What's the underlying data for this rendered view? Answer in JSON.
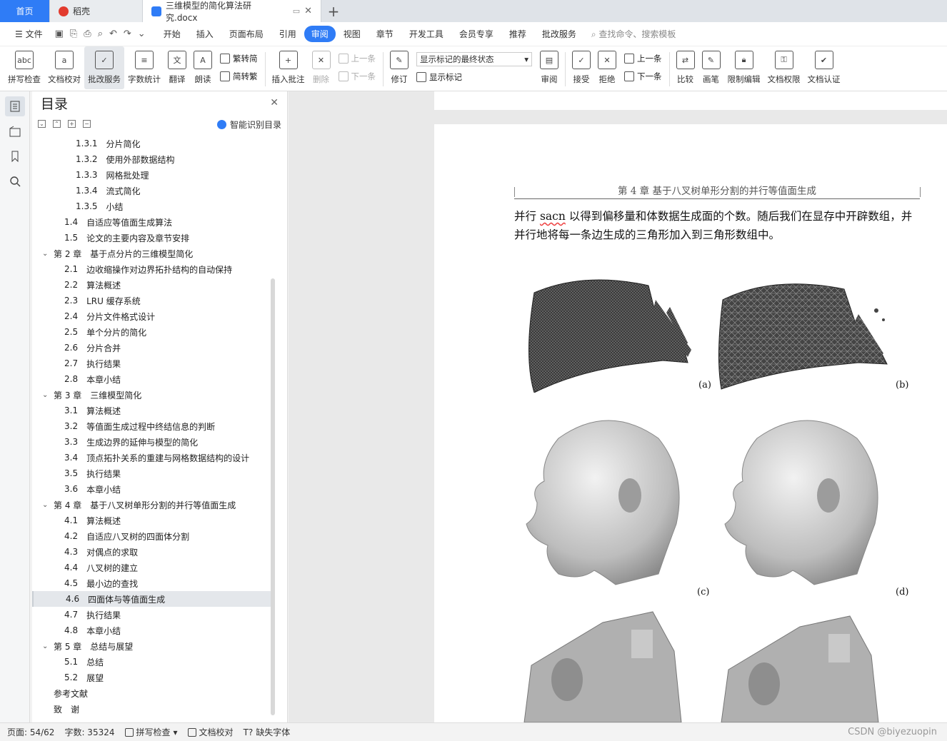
{
  "tabs": {
    "home": "首页",
    "daoke": "稻壳",
    "doc": "三维模型的简化算法研究.docx"
  },
  "menu": {
    "file": "文件",
    "items": [
      "开始",
      "插入",
      "页面布局",
      "引用",
      "审阅",
      "视图",
      "章节",
      "开发工具",
      "会员专享",
      "推荐",
      "批改服务"
    ],
    "active_index": 4,
    "search": "查找命令、搜索模板"
  },
  "ribbon": {
    "spellcheck": "拼写检查",
    "proofread": "文档校对",
    "correction": "批改服务",
    "wordcount": "字数统计",
    "translate": "翻译",
    "read": "朗读",
    "trad": "繁转简",
    "simp": "简转繁",
    "insert_comment": "插入批注",
    "delete": "删除",
    "prev": "上一条",
    "next": "下一条",
    "revise": "修订",
    "markup_state": "显示标记的最终状态",
    "show_markup": "显示标记",
    "review": "审阅",
    "accept": "接受",
    "reject": "拒绝",
    "prev2": "上一条",
    "next2": "下一条",
    "compare": "比较",
    "pen": "画笔",
    "restrict": "限制编辑",
    "permission": "文档权限",
    "certify": "文档认证"
  },
  "toc": {
    "title": "目录",
    "smart": "智能识别目录",
    "items": [
      {
        "level": 2,
        "num": "1.3.1",
        "text": "分片简化"
      },
      {
        "level": 2,
        "num": "1.3.2",
        "text": "使用外部数据结构"
      },
      {
        "level": 2,
        "num": "1.3.3",
        "text": "网格批处理"
      },
      {
        "level": 2,
        "num": "1.3.4",
        "text": "流式简化"
      },
      {
        "level": 2,
        "num": "1.3.5",
        "text": "小结"
      },
      {
        "level": 1,
        "num": "1.4",
        "text": "自适应等值面生成算法"
      },
      {
        "level": 1,
        "num": "1.5",
        "text": "论文的主要内容及章节安排"
      },
      {
        "level": 0,
        "num": "第 2 章",
        "text": "基于点分片的三维模型简化"
      },
      {
        "level": 1,
        "num": "2.1",
        "text": "边收缩操作对边界拓扑结构的自动保持"
      },
      {
        "level": 1,
        "num": "2.2",
        "text": "算法概述"
      },
      {
        "level": 1,
        "num": "2.3",
        "text": "LRU 缓存系统"
      },
      {
        "level": 1,
        "num": "2.4",
        "text": "分片文件格式设计"
      },
      {
        "level": 1,
        "num": "2.5",
        "text": "单个分片的简化"
      },
      {
        "level": 1,
        "num": "2.6",
        "text": "分片合并"
      },
      {
        "level": 1,
        "num": "2.7",
        "text": "执行结果"
      },
      {
        "level": 1,
        "num": "2.8",
        "text": "本章小结"
      },
      {
        "level": 0,
        "num": "第 3 章",
        "text": "三维模型简化"
      },
      {
        "level": 1,
        "num": "3.1",
        "text": "算法概述"
      },
      {
        "level": 1,
        "num": "3.2",
        "text": "等值面生成过程中终结信息的判断"
      },
      {
        "level": 1,
        "num": "3.3",
        "text": "生成边界的延伸与模型的简化"
      },
      {
        "level": 1,
        "num": "3.4",
        "text": "顶点拓扑关系的重建与网格数据结构的设计"
      },
      {
        "level": 1,
        "num": "3.5",
        "text": "执行结果"
      },
      {
        "level": 1,
        "num": "3.6",
        "text": "本章小结"
      },
      {
        "level": 0,
        "num": "第 4 章",
        "text": "基于八叉树单形分割的并行等值面生成"
      },
      {
        "level": 1,
        "num": "4.1",
        "text": "算法概述"
      },
      {
        "level": 1,
        "num": "4.2",
        "text": "自适应八叉树的四面体分割"
      },
      {
        "level": 1,
        "num": "4.3",
        "text": "对偶点的求取"
      },
      {
        "level": 1,
        "num": "4.4",
        "text": "八叉树的建立"
      },
      {
        "level": 1,
        "num": "4.5",
        "text": "最小边的查找"
      },
      {
        "level": 1,
        "num": "4.6",
        "text": "四面体与等值面生成",
        "selected": true
      },
      {
        "level": 1,
        "num": "4.7",
        "text": "执行结果"
      },
      {
        "level": 1,
        "num": "4.8",
        "text": "本章小结"
      },
      {
        "level": 0,
        "num": "第 5 章",
        "text": "总结与展望"
      },
      {
        "level": 1,
        "num": "5.1",
        "text": "总结"
      },
      {
        "level": 1,
        "num": "5.2",
        "text": "展望"
      },
      {
        "level": 3,
        "num": "",
        "text": "参考文献"
      },
      {
        "level": 3,
        "num": "",
        "text": "致　谢"
      }
    ]
  },
  "document": {
    "running_head": "第 4 章  基于八叉树单形分割的并行等值面生成",
    "para_pre": "并行 ",
    "para_sq": "sacn",
    "para_post": " 以得到偏移量和体数据生成面的个数。随后我们在显存中开辟数组，并并行地将每一条边生成的三角形加入到三角形数组中。",
    "labels": [
      "(a)",
      "(b)",
      "(c)",
      "(d)"
    ]
  },
  "status": {
    "page": "页面: 54/62",
    "words": "字数: 35324",
    "spell": "拼写检查",
    "proof": "文档校对",
    "font": "缺失字体",
    "watermark": "CSDN @biyezuopin"
  },
  "colors": {
    "accent": "#2f7cf6",
    "tabbar": "#dfe3e8"
  }
}
